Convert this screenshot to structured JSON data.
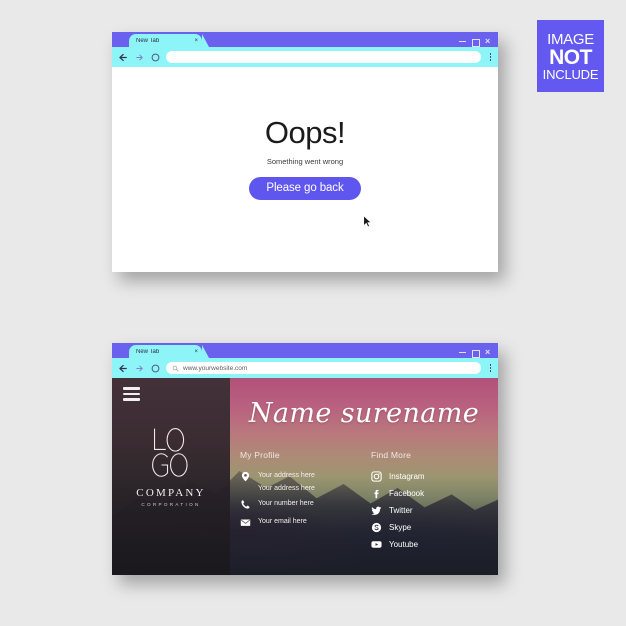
{
  "page": {
    "background_color": "#e9e9e9",
    "accent_purple": "#5f56ef",
    "toolbar_cyan": "#8df4f7"
  },
  "image_badge": {
    "line1": "IMAGE",
    "line2": "NOT",
    "line3": "INCLUDE",
    "background_color": "#6359f0"
  },
  "browser_error": {
    "tab": {
      "label": "New Tab",
      "close_label": "×"
    },
    "window_controls": {
      "minimize": "minimize-icon",
      "maximize": "maximize-icon",
      "close": "×"
    },
    "toolbar": {
      "back_icon": "back-arrow-icon",
      "forward_icon": "forward-arrow-icon",
      "reload_icon": "reload-icon",
      "url_value": "",
      "url_placeholder": "",
      "menu_icon": "kebab-menu-icon"
    },
    "content": {
      "heading": "Oops!",
      "subtitle": "Something went wrong",
      "button_label": "Please go back",
      "cursor_icon": "mouse-pointer-icon"
    }
  },
  "browser_site": {
    "tab": {
      "label": "New Tab",
      "close_label": "×"
    },
    "window_controls": {
      "minimize": "minimize-icon",
      "maximize": "maximize-icon",
      "close": "×"
    },
    "toolbar": {
      "back_icon": "back-arrow-icon",
      "forward_icon": "forward-arrow-icon",
      "reload_icon": "reload-icon",
      "search_icon": "search-icon",
      "url_value": "www.yourwebsite.com",
      "menu_icon": "kebab-menu-icon"
    },
    "sidebar": {
      "menu_icon": "hamburger-menu-icon",
      "logo_icon": "logo-monogram-icon",
      "company_name": "COMPANY",
      "company_sub": "CORPORATION"
    },
    "hero": {
      "title": "Name surename"
    },
    "profile": {
      "heading": "My Profile",
      "items": [
        {
          "icon": "location-pin-icon",
          "label": "Your address here",
          "label2": "Your address here"
        },
        {
          "icon": "phone-icon",
          "label": "Your number here"
        },
        {
          "icon": "envelope-icon",
          "label": "Your email here"
        }
      ]
    },
    "find_more": {
      "heading": "Find More",
      "items": [
        {
          "icon": "instagram-icon",
          "label": "Instagram"
        },
        {
          "icon": "facebook-icon",
          "label": "Facebook"
        },
        {
          "icon": "twitter-icon",
          "label": "Twitter"
        },
        {
          "icon": "skype-icon",
          "label": "Skype"
        },
        {
          "icon": "youtube-icon",
          "label": "Youtube"
        }
      ]
    }
  }
}
